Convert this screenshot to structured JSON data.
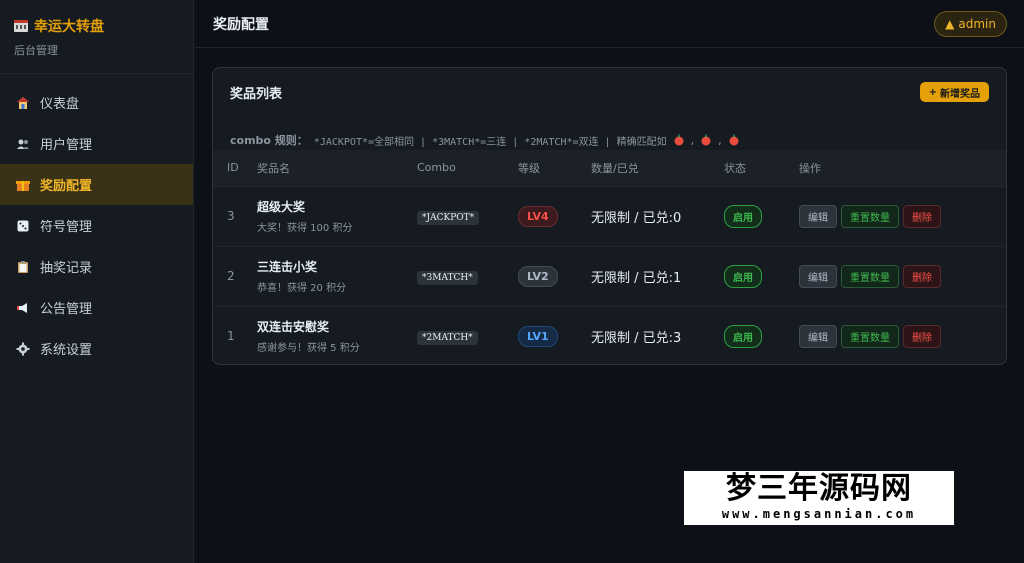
{
  "brand": {
    "title": "幸运大转盘",
    "subtitle": "后台管理",
    "icon": "slot-machine-icon"
  },
  "sidebar": {
    "items": [
      {
        "label": "仪表盘",
        "icon": "home-icon",
        "active": false
      },
      {
        "label": "用户管理",
        "icon": "users-icon",
        "active": false
      },
      {
        "label": "奖励配置",
        "icon": "gift-icon",
        "active": true
      },
      {
        "label": "符号管理",
        "icon": "dice-icon",
        "active": false
      },
      {
        "label": "抽奖记录",
        "icon": "clipboard-icon",
        "active": false
      },
      {
        "label": "公告管理",
        "icon": "megaphone-icon",
        "active": false
      },
      {
        "label": "系统设置",
        "icon": "gear-icon",
        "active": false
      }
    ]
  },
  "header": {
    "title": "奖励配置",
    "user": "admin",
    "user_icon": "triangle-up-icon"
  },
  "card": {
    "title": "奖品列表",
    "add_label": "新增奖品",
    "combo_rule": {
      "label": "combo 规则：",
      "text": "*JACKPOT*=全部相同 | *3MATCH*=三连 | *2MATCH*=双连 | 精确匹配如",
      "example_icon": "apple-icon"
    },
    "columns": [
      "ID",
      "奖品名",
      "Combo",
      "等级",
      "数量/已兑",
      "状态",
      "操作"
    ],
    "rows": [
      {
        "id": "3",
        "name": "超级大奖",
        "desc": "大奖！获得 100 积分",
        "combo": "*JACKPOT*",
        "level": "LV4",
        "qty": "无限制 / 已兑:0",
        "status": "启用"
      },
      {
        "id": "2",
        "name": "三连击小奖",
        "desc": "恭喜！获得 20 积分",
        "combo": "*3MATCH*",
        "level": "LV2",
        "qty": "无限制 / 已兑:1",
        "status": "启用"
      },
      {
        "id": "1",
        "name": "双连击安慰奖",
        "desc": "感谢参与！获得 5 积分",
        "combo": "*2MATCH*",
        "level": "LV1",
        "qty": "无限制 / 已兑:3",
        "status": "启用"
      }
    ],
    "actions": {
      "edit": "编辑",
      "reset": "重置数量",
      "delete": "删除"
    }
  },
  "watermark": {
    "title": "梦三年源码网",
    "url": "www.mengsannian.com"
  },
  "colors": {
    "accent": "#e3a008",
    "active_bg": "#3a3216",
    "success": "#3fb950",
    "danger": "#f85149",
    "info": "#58a6ff"
  }
}
